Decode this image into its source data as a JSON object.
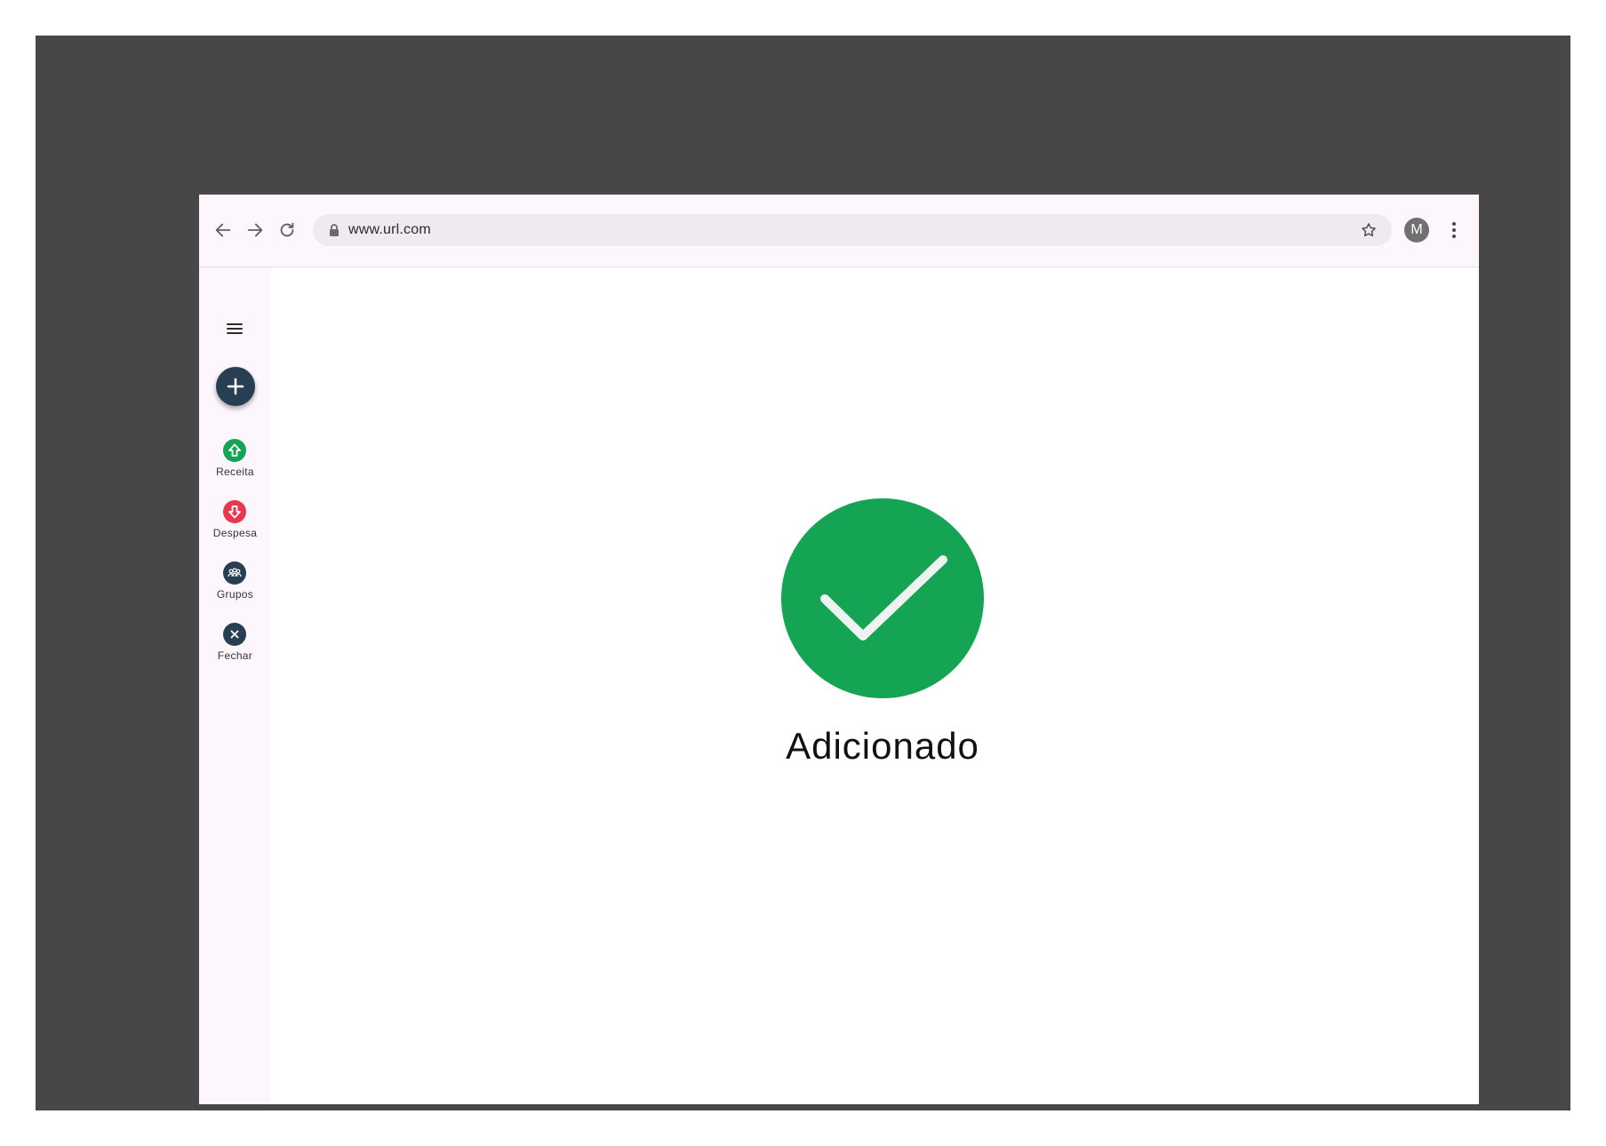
{
  "browser": {
    "url": "www.url.com",
    "avatar_initial": "M",
    "icons": {
      "back": "arrow-left-icon",
      "forward": "arrow-right-icon",
      "reload": "reload-icon",
      "lock": "lock-icon",
      "bookmark": "star-icon",
      "menu": "kebab-menu-icon"
    }
  },
  "sidebar": {
    "menu_icon": "hamburger-icon",
    "fab_icon": "plus-icon",
    "items": [
      {
        "label": "Receita",
        "icon": "arrow-up-circle-icon",
        "color": "#15a454"
      },
      {
        "label": "Despesa",
        "icon": "arrow-down-circle-icon",
        "color": "#e8384f"
      },
      {
        "label": "Grupos",
        "icon": "group-icon",
        "color": "#283e52"
      },
      {
        "label": "Fechar",
        "icon": "close-icon",
        "color": "#283e52"
      }
    ]
  },
  "main": {
    "status_icon": "checkmark-icon",
    "status_color": "#15a454",
    "message": "Adicionado"
  }
}
